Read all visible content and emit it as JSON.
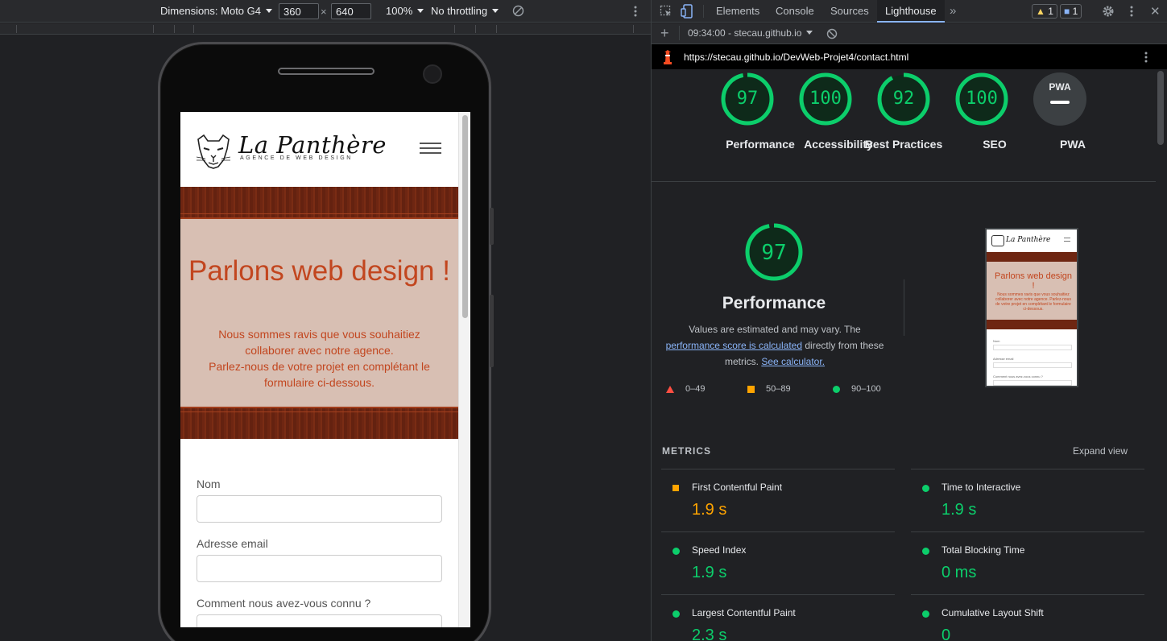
{
  "devicebar": {
    "dimensions_label": "Dimensions: Moto G4",
    "width": "360",
    "times": "×",
    "height": "640",
    "zoom": "100%",
    "throttling": "No throttling"
  },
  "site": {
    "logo_title": "La Panthère",
    "logo_subtitle": "AGENCE DE WEB DESIGN",
    "hero_title": "Parlons web design !",
    "hero_line1": "Nous sommes ravis que vous souhaitiez collaborer avec notre agence.",
    "hero_line2": "Parlez-nous de votre projet en complétant le formulaire ci-dessous.",
    "form": {
      "name_label": "Nom",
      "email_label": "Adresse email",
      "source_label": "Comment nous avez-vous connu ?"
    }
  },
  "devtools": {
    "tabs": [
      "Elements",
      "Console",
      "Sources",
      "Lighthouse"
    ],
    "active_tab": "Lighthouse",
    "warnings": "1",
    "messages": "1",
    "report_select": "09:34:00 - stecau.github.io",
    "url": "https://stecau.github.io/DevWeb-Projet4/contact.html"
  },
  "lighthouse": {
    "categories": [
      {
        "label": "Performance",
        "score": 97
      },
      {
        "label": "Accessibility",
        "score": 100
      },
      {
        "label": "Best Practices",
        "score": 92
      },
      {
        "label": "SEO",
        "score": 100
      },
      {
        "label": "PWA",
        "score": null
      }
    ],
    "pwa_badge": "PWA",
    "perf": {
      "score": "97",
      "title": "Performance",
      "desc_prefix": "Values are estimated and may vary. The",
      "desc_link": "performance score is calculated",
      "desc_suffix": "directly from these metrics.",
      "calc_link": "See calculator.",
      "legend": {
        "fail": "0–49",
        "average": "50–89",
        "pass": "90–100"
      }
    },
    "thumb": {
      "brand": "La Panthère",
      "title": "Parlons web design !",
      "text": "Nous sommes ravis que vous souhaitiez collaborer avec notre agence. Parlez-nous de votre projet en complétant le formulaire ci-dessous.",
      "l1": "Nom",
      "l2": "Adresse email",
      "l3": "Comment nous avez-vous connu ?"
    },
    "metrics_heading": "METRICS",
    "expand_view": "Expand view",
    "metrics": [
      {
        "name": "First Contentful Paint",
        "value": "1.9 s",
        "rating": "average"
      },
      {
        "name": "Time to Interactive",
        "value": "1.9 s",
        "rating": "pass"
      },
      {
        "name": "Speed Index",
        "value": "1.9 s",
        "rating": "pass"
      },
      {
        "name": "Total Blocking Time",
        "value": "0 ms",
        "rating": "pass"
      },
      {
        "name": "Largest Contentful Paint",
        "value": "2.3 s",
        "rating": "pass"
      },
      {
        "name": "Cumulative Layout Shift",
        "value": "0",
        "rating": "pass"
      }
    ],
    "colors": {
      "pass": "#0cce6b",
      "average": "#ffa400",
      "fail": "#ff4e42"
    }
  }
}
